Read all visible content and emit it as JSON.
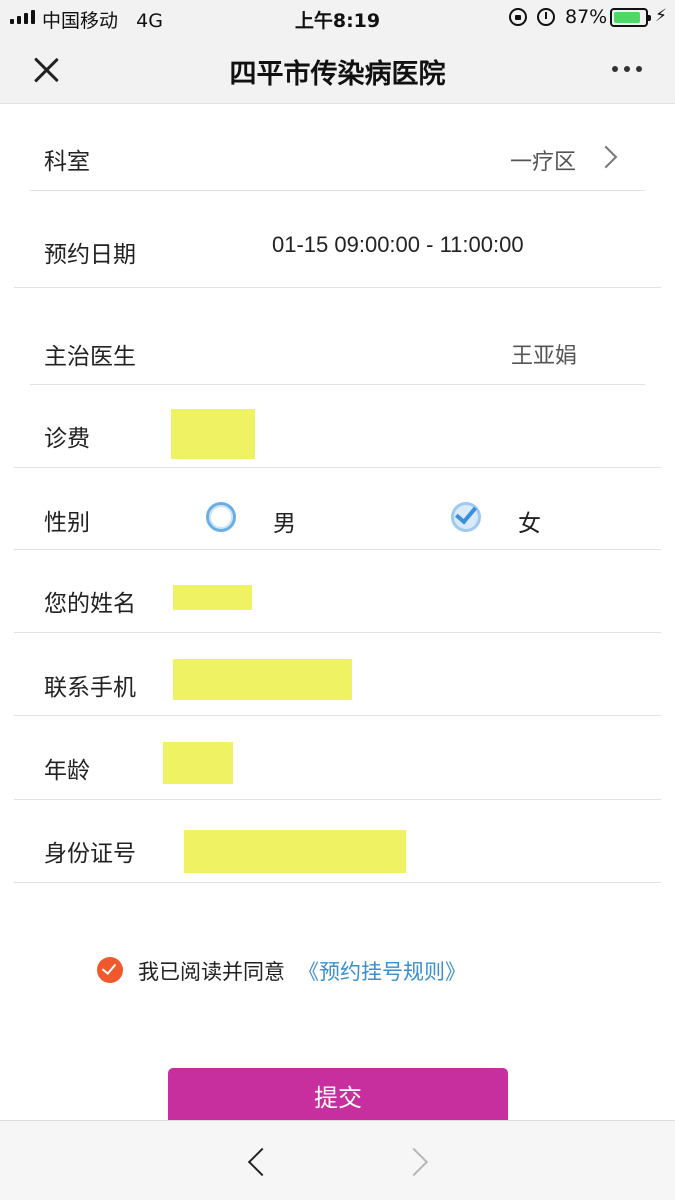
{
  "status_bar": {
    "carrier": "中国移动",
    "network": "4G",
    "time": "上午8:19",
    "battery_percent": "87%",
    "battery_level": 0.87,
    "icons": [
      "signal-icon",
      "lock-rotation-icon",
      "alarm-icon",
      "battery-icon",
      "charging-bolt-icon"
    ]
  },
  "nav": {
    "title": "四平市传染病医院",
    "close_icon": "close-icon",
    "more_icon": "more-icon"
  },
  "form": {
    "department": {
      "label": "科室",
      "value": "一疗区"
    },
    "appointment_date": {
      "label": "预约日期",
      "value": "01-15 09:00:00 - 11:00:00"
    },
    "doctor": {
      "label": "主治医生",
      "value": "王亚娟"
    },
    "fee": {
      "label": "诊费"
    },
    "gender": {
      "label": "性别",
      "options": [
        {
          "label": "男",
          "selected": false
        },
        {
          "label": "女",
          "selected": true
        }
      ]
    },
    "name": {
      "label": "您的姓名"
    },
    "phone": {
      "label": "联系手机"
    },
    "age": {
      "label": "年龄"
    },
    "id_number": {
      "label": "身份证号"
    }
  },
  "agreement": {
    "checked": true,
    "text": "我已阅读并同意",
    "link": "《预约挂号规则》"
  },
  "submit": {
    "label": "提交"
  },
  "colors": {
    "accent_submit": "#c72f9f",
    "agree_check": "#f0592b",
    "link": "#3a8fd0",
    "redaction": "#eff263",
    "battery": "#4cd964"
  }
}
